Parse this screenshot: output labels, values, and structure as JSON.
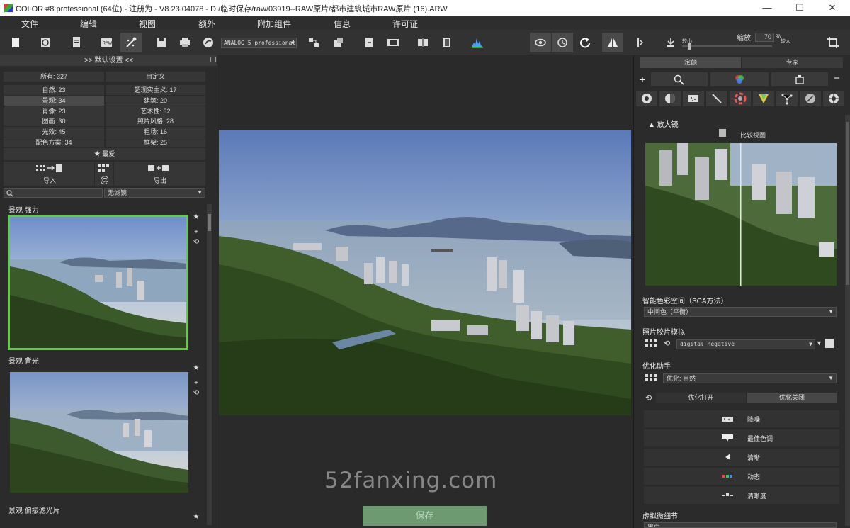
{
  "window": {
    "title": "COLOR #8 professional (64位) - 注册为 - V8.23.04078 - D:/临时保存/raw/03919--RAW原片/都市建筑城市RAW原片 (16).ARW",
    "minimize": "—",
    "maximize": "☐",
    "close": "✕"
  },
  "menu": [
    "文件",
    "编辑",
    "视图",
    "额外",
    "附加组件",
    "信息",
    "许可证"
  ],
  "toolbar": {
    "film_select": "ANALOG 5 professional",
    "zoom_label": "缩放",
    "zoom_value": "70",
    "zoom_unit": "%",
    "smaller": "较小",
    "larger": "较大"
  },
  "left_panel": {
    "header": ">> 默认设置 <<",
    "categories": [
      [
        "所有: 327",
        "自定义"
      ],
      [
        "自然: 23",
        "超现实主义: 17"
      ],
      [
        "景观: 34",
        "建筑: 20"
      ],
      [
        "肖像: 23",
        "艺术性: 32"
      ],
      [
        "图画: 30",
        "照片风格: 28"
      ],
      [
        "光效: 45",
        "粗场: 16"
      ],
      [
        "配色方案: 34",
        "框架: 25"
      ]
    ],
    "selected_category": "景观: 34",
    "favorites": "★ 最爱",
    "import": "导入",
    "export": "导出",
    "at": "@",
    "filter_value": "无滤镜",
    "presets": [
      {
        "title": "景观  强力"
      },
      {
        "title": "景观  背光"
      },
      {
        "title": "景观  偏振滤光片"
      }
    ]
  },
  "center": {
    "save_button": "保存",
    "watermark": "52fanxing.com"
  },
  "right_panel": {
    "tabs": [
      "定额",
      "专家"
    ],
    "plus": "+",
    "minus": "−",
    "loupe": "放大镜",
    "compare_view": "比较视图",
    "smart_color_space": "智能色彩空间（SCA方法）",
    "smart_color_value": "中间色（平衡）",
    "film_emulation": "照片胶片模拟",
    "film_value": "digital negative",
    "optimize_assistant": "优化助手",
    "optimize_value": "优化: 自然",
    "optimize_on": "优化打开",
    "optimize_off": "优化关闭",
    "options": [
      "降噪",
      "最佳色调",
      "清晰",
      "动态",
      "清晰度"
    ],
    "virtual_detail": "虚拟微细节",
    "virtual_detail_value": "黑白"
  }
}
